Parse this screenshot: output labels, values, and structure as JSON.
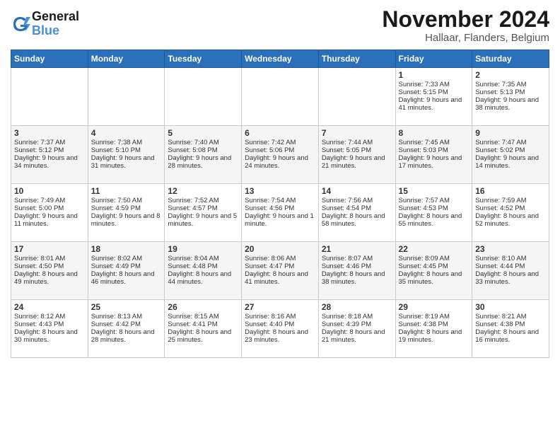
{
  "header": {
    "logo_line1": "General",
    "logo_line2": "Blue",
    "month_year": "November 2024",
    "location": "Hallaar, Flanders, Belgium"
  },
  "weekdays": [
    "Sunday",
    "Monday",
    "Tuesday",
    "Wednesday",
    "Thursday",
    "Friday",
    "Saturday"
  ],
  "weeks": [
    [
      {
        "day": "",
        "info": ""
      },
      {
        "day": "",
        "info": ""
      },
      {
        "day": "",
        "info": ""
      },
      {
        "day": "",
        "info": ""
      },
      {
        "day": "",
        "info": ""
      },
      {
        "day": "1",
        "info": "Sunrise: 7:33 AM\nSunset: 5:15 PM\nDaylight: 9 hours and 41 minutes."
      },
      {
        "day": "2",
        "info": "Sunrise: 7:35 AM\nSunset: 5:13 PM\nDaylight: 9 hours and 38 minutes."
      }
    ],
    [
      {
        "day": "3",
        "info": "Sunrise: 7:37 AM\nSunset: 5:12 PM\nDaylight: 9 hours and 34 minutes."
      },
      {
        "day": "4",
        "info": "Sunrise: 7:38 AM\nSunset: 5:10 PM\nDaylight: 9 hours and 31 minutes."
      },
      {
        "day": "5",
        "info": "Sunrise: 7:40 AM\nSunset: 5:08 PM\nDaylight: 9 hours and 28 minutes."
      },
      {
        "day": "6",
        "info": "Sunrise: 7:42 AM\nSunset: 5:06 PM\nDaylight: 9 hours and 24 minutes."
      },
      {
        "day": "7",
        "info": "Sunrise: 7:44 AM\nSunset: 5:05 PM\nDaylight: 9 hours and 21 minutes."
      },
      {
        "day": "8",
        "info": "Sunrise: 7:45 AM\nSunset: 5:03 PM\nDaylight: 9 hours and 17 minutes."
      },
      {
        "day": "9",
        "info": "Sunrise: 7:47 AM\nSunset: 5:02 PM\nDaylight: 9 hours and 14 minutes."
      }
    ],
    [
      {
        "day": "10",
        "info": "Sunrise: 7:49 AM\nSunset: 5:00 PM\nDaylight: 9 hours and 11 minutes."
      },
      {
        "day": "11",
        "info": "Sunrise: 7:50 AM\nSunset: 4:59 PM\nDaylight: 9 hours and 8 minutes."
      },
      {
        "day": "12",
        "info": "Sunrise: 7:52 AM\nSunset: 4:57 PM\nDaylight: 9 hours and 5 minutes."
      },
      {
        "day": "13",
        "info": "Sunrise: 7:54 AM\nSunset: 4:56 PM\nDaylight: 9 hours and 1 minute."
      },
      {
        "day": "14",
        "info": "Sunrise: 7:56 AM\nSunset: 4:54 PM\nDaylight: 8 hours and 58 minutes."
      },
      {
        "day": "15",
        "info": "Sunrise: 7:57 AM\nSunset: 4:53 PM\nDaylight: 8 hours and 55 minutes."
      },
      {
        "day": "16",
        "info": "Sunrise: 7:59 AM\nSunset: 4:52 PM\nDaylight: 8 hours and 52 minutes."
      }
    ],
    [
      {
        "day": "17",
        "info": "Sunrise: 8:01 AM\nSunset: 4:50 PM\nDaylight: 8 hours and 49 minutes."
      },
      {
        "day": "18",
        "info": "Sunrise: 8:02 AM\nSunset: 4:49 PM\nDaylight: 8 hours and 46 minutes."
      },
      {
        "day": "19",
        "info": "Sunrise: 8:04 AM\nSunset: 4:48 PM\nDaylight: 8 hours and 44 minutes."
      },
      {
        "day": "20",
        "info": "Sunrise: 8:06 AM\nSunset: 4:47 PM\nDaylight: 8 hours and 41 minutes."
      },
      {
        "day": "21",
        "info": "Sunrise: 8:07 AM\nSunset: 4:46 PM\nDaylight: 8 hours and 38 minutes."
      },
      {
        "day": "22",
        "info": "Sunrise: 8:09 AM\nSunset: 4:45 PM\nDaylight: 8 hours and 35 minutes."
      },
      {
        "day": "23",
        "info": "Sunrise: 8:10 AM\nSunset: 4:44 PM\nDaylight: 8 hours and 33 minutes."
      }
    ],
    [
      {
        "day": "24",
        "info": "Sunrise: 8:12 AM\nSunset: 4:43 PM\nDaylight: 8 hours and 30 minutes."
      },
      {
        "day": "25",
        "info": "Sunrise: 8:13 AM\nSunset: 4:42 PM\nDaylight: 8 hours and 28 minutes."
      },
      {
        "day": "26",
        "info": "Sunrise: 8:15 AM\nSunset: 4:41 PM\nDaylight: 8 hours and 25 minutes."
      },
      {
        "day": "27",
        "info": "Sunrise: 8:16 AM\nSunset: 4:40 PM\nDaylight: 8 hours and 23 minutes."
      },
      {
        "day": "28",
        "info": "Sunrise: 8:18 AM\nSunset: 4:39 PM\nDaylight: 8 hours and 21 minutes."
      },
      {
        "day": "29",
        "info": "Sunrise: 8:19 AM\nSunset: 4:38 PM\nDaylight: 8 hours and 19 minutes."
      },
      {
        "day": "30",
        "info": "Sunrise: 8:21 AM\nSunset: 4:38 PM\nDaylight: 8 hours and 16 minutes."
      }
    ]
  ]
}
